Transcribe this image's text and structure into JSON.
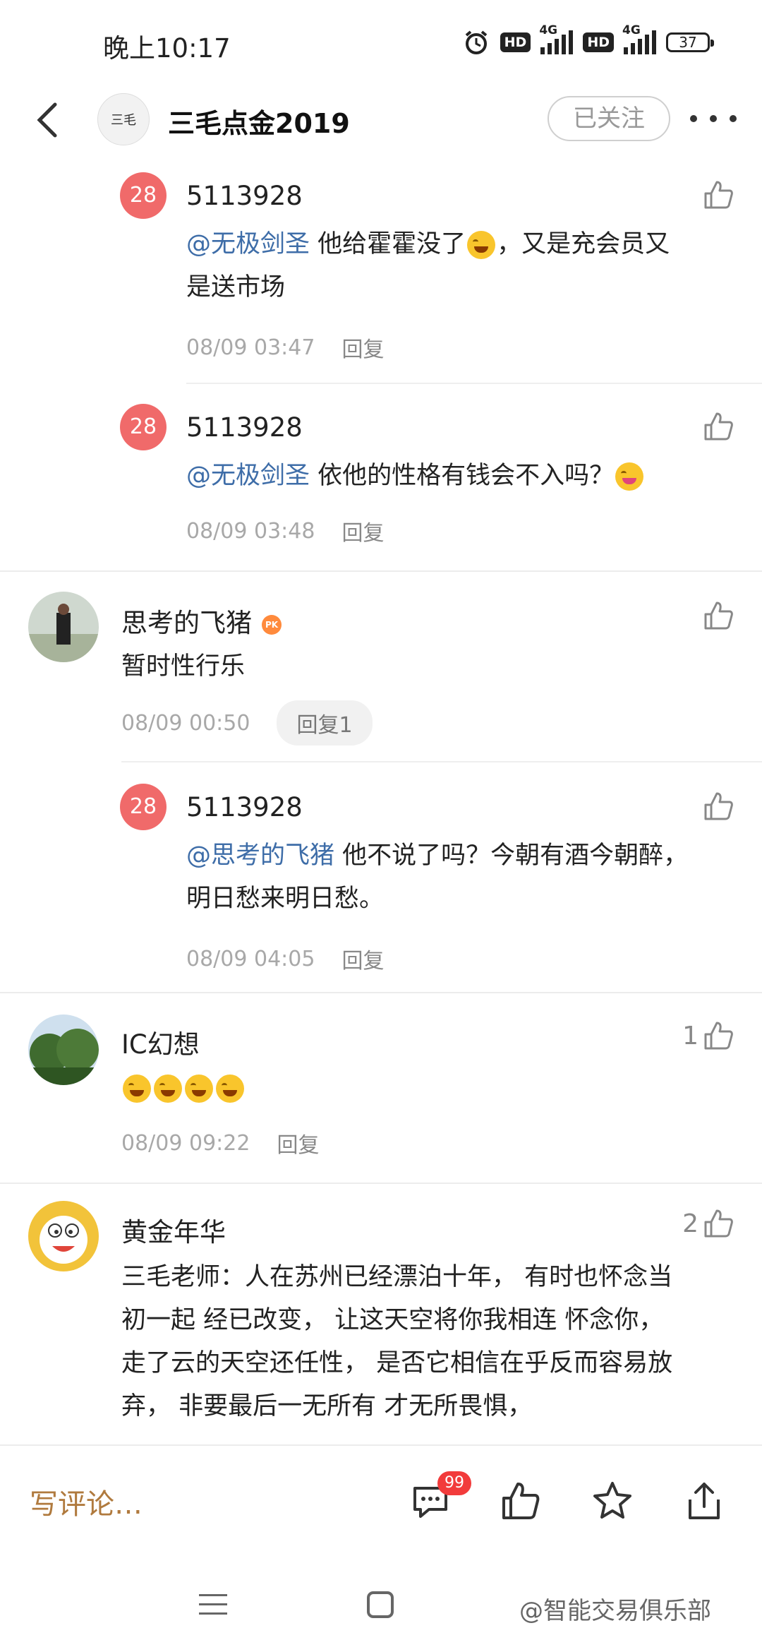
{
  "status_bar": {
    "time": "晚上10:17",
    "hd1": "HD",
    "net1": "4G",
    "hd2": "HD",
    "net2": "4G",
    "battery": "37"
  },
  "header": {
    "title": "三毛点金2019",
    "avatar_text": "三毛",
    "follow_label": "已关注"
  },
  "comments": [
    {
      "user": "5113928",
      "avatar_num": "28",
      "mention": "@无极剑圣",
      "text_a": " 他给霍霍没了",
      "text_b": "，又是充会员又",
      "text_line2": "是送市场",
      "time": "08/09 03:47",
      "reply": "回复"
    },
    {
      "user": "5113928",
      "avatar_num": "28",
      "mention": "@无极剑圣",
      "text_a": " 依他的性格有钱会不入吗？",
      "time": "08/09 03:48",
      "reply": "回复"
    },
    {
      "user": "思考的飞猪",
      "badge": "PK",
      "text": "暂时性行乐",
      "time": "08/09 00:50",
      "reply": "回复1"
    },
    {
      "user": "5113928",
      "avatar_num": "28",
      "mention": "@思考的飞猪",
      "text_a": " 他不说了吗？今朝有酒今朝醉，",
      "text_line2": "明日愁来明日愁。",
      "time": "08/09 04:05",
      "reply": "回复"
    },
    {
      "user": "IC幻想",
      "likes": "1",
      "time": "08/09 09:22",
      "reply": "回复"
    },
    {
      "user": "黄金年华",
      "likes": "2",
      "lines": [
        "三毛老师：人在苏州已经漂泊十年， 有时也怀念当",
        "初一起 经已改变， 让这天空将你我相连 怀念你，",
        "走了云的天空还任性， 是否它相信在乎反而容易放",
        "弃， 非要最后一无所有 才无所畏惧，"
      ]
    }
  ],
  "bottom_bar": {
    "write_placeholder": "写评论…",
    "comment_count": "99"
  },
  "watermark": "@智能交易俱乐部",
  "colors": {
    "mention": "#3e6da8",
    "avatar_red": "#f06a6a",
    "write": "#b07a3e",
    "badge": "#f23b3b"
  }
}
